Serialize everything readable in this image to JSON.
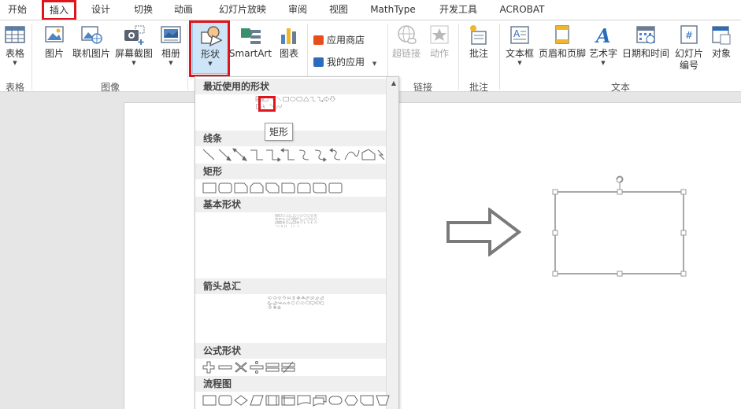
{
  "tabs": [
    "开始",
    "插入",
    "设计",
    "切换",
    "动画",
    "幻灯片放映",
    "审阅",
    "视图",
    "MathType",
    "开发工具",
    "ACROBAT"
  ],
  "active_tab": "插入",
  "ribbon": {
    "table": {
      "label": "表格",
      "group": "表格"
    },
    "image_group": "图像",
    "picture": "图片",
    "online_picture": "联机图片",
    "screenshot": "屏幕截图",
    "album": "相册",
    "shapes": "形状",
    "smartart": "SmartArt",
    "chart": "图表",
    "app_store": "应用商店",
    "my_apps": "我的应用",
    "hyperlink": "超链接",
    "action": "动作",
    "links_group": "链接",
    "comment": "批注",
    "comment_group": "批注",
    "textbox": "文本框",
    "header_footer": "页眉和页脚",
    "wordart": "艺术字",
    "datetime": "日期和时间",
    "slide_number_1": "幻灯片",
    "slide_number_2": "编号",
    "object": "对象",
    "text_group": "文本"
  },
  "dropdown": {
    "sections": [
      "最近使用的形状",
      "线条",
      "矩形",
      "基本形状",
      "箭头总汇",
      "公式形状",
      "流程图"
    ],
    "tooltip": "矩形"
  },
  "colors": {
    "highlight": "#e0141c",
    "shape_stroke": "#666666",
    "selection_handle": "#999999"
  }
}
